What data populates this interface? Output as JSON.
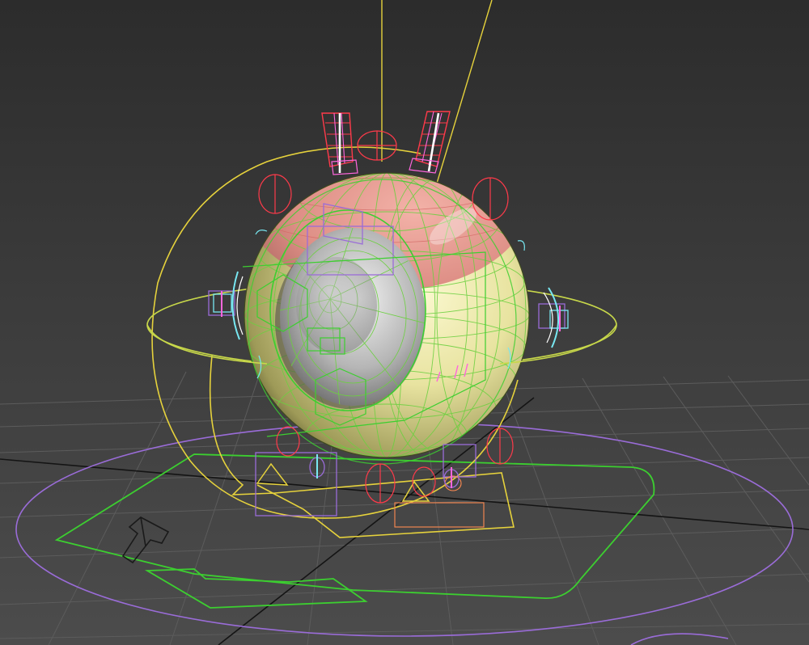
{
  "viewport": {
    "label": "",
    "background_top": "#2c2c2c",
    "background_bottom": "#4c4c4c",
    "grid_color": "#5c5c5c",
    "axis_line_color": "#141414"
  },
  "rig_colors": {
    "eye_shell": "#e8e3a0",
    "eye_shell_top": "#de8f86",
    "wire_mesh": "#6cd040",
    "iris": "#b6b6b6",
    "pupil_mesh": "#6cd040",
    "control_yellow": "#e6d23c",
    "control_green": "#3ccf30",
    "control_violet": "#9a6cd8",
    "control_red": "#ff3a4a",
    "control_magenta": "#ff66dd",
    "control_cyan": "#78e8f2",
    "control_orange": "#ff8a50"
  },
  "objects": [
    {
      "id": "eyeball",
      "icon": "sphere-icon"
    },
    {
      "id": "iris",
      "icon": "disc-icon"
    },
    {
      "id": "lid-bones",
      "icon": "bone-icon"
    },
    {
      "id": "ground-controller",
      "icon": "circle-icon"
    },
    {
      "id": "direction-arrow",
      "icon": "arrow-icon"
    }
  ]
}
